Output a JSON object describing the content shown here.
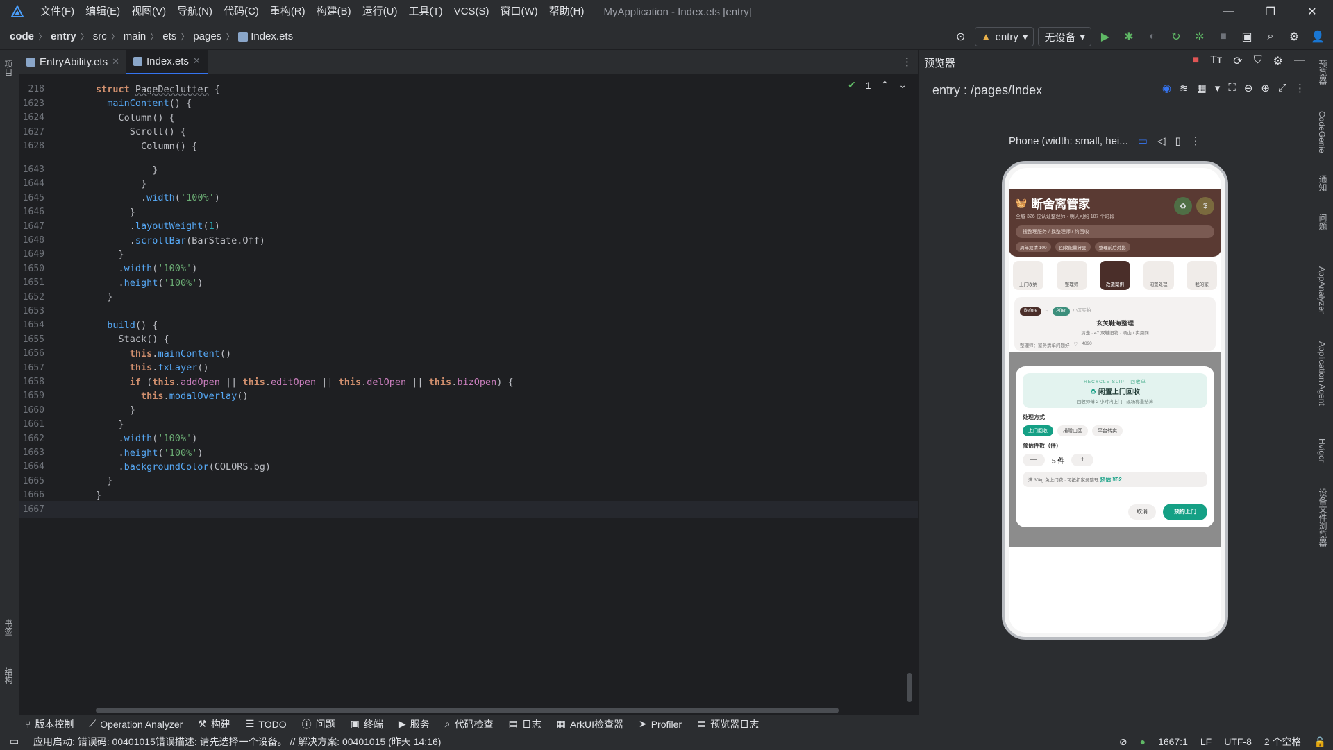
{
  "menubar": {
    "items": [
      "文件(F)",
      "编辑(E)",
      "视图(V)",
      "导航(N)",
      "代码(C)",
      "重构(R)",
      "构建(B)",
      "运行(U)",
      "工具(T)",
      "VCS(S)",
      "窗口(W)",
      "帮助(H)"
    ],
    "window_title": "MyApplication - Index.ets [entry]"
  },
  "breadcrumb": [
    "code",
    "entry",
    "src",
    "main",
    "ets",
    "pages",
    "Index.ets"
  ],
  "toolbar": {
    "module": "entry",
    "device": "无设备"
  },
  "left_strip": {
    "project": "项目",
    "bookmarks": "书签",
    "structure": "结构"
  },
  "tabs": [
    {
      "label": "EntryAbility.ets"
    },
    {
      "label": "Index.ets"
    }
  ],
  "editor": {
    "inspection_count": "1",
    "sticky": [
      {
        "ln": "218",
        "text": "struct PageDeclutter {"
      },
      {
        "ln": "1623",
        "text": "  mainContent() {"
      },
      {
        "ln": "1624",
        "text": "    Column() {"
      },
      {
        "ln": "1627",
        "text": "      Scroll() {"
      },
      {
        "ln": "1628",
        "text": "        Column() {"
      }
    ],
    "lines": [
      {
        "ln": "1643",
        "text": "          }"
      },
      {
        "ln": "1644",
        "text": "        }"
      },
      {
        "ln": "1645",
        "text": "        .width('100%')"
      },
      {
        "ln": "1646",
        "text": "      }"
      },
      {
        "ln": "1647",
        "text": "      .layoutWeight(1)"
      },
      {
        "ln": "1648",
        "text": "      .scrollBar(BarState.Off)"
      },
      {
        "ln": "1649",
        "text": "    }"
      },
      {
        "ln": "1650",
        "text": "    .width('100%')"
      },
      {
        "ln": "1651",
        "text": "    .height('100%')"
      },
      {
        "ln": "1652",
        "text": "  }"
      },
      {
        "ln": "1653",
        "text": ""
      },
      {
        "ln": "1654",
        "text": "  build() {"
      },
      {
        "ln": "1655",
        "text": "    Stack() {"
      },
      {
        "ln": "1656",
        "text": "      this.mainContent()"
      },
      {
        "ln": "1657",
        "text": "      this.fxLayer()"
      },
      {
        "ln": "1658",
        "text": "      if (this.addOpen || this.editOpen || this.delOpen || this.bizOpen) {"
      },
      {
        "ln": "1659",
        "text": "        this.modalOverlay()"
      },
      {
        "ln": "1660",
        "text": "      }"
      },
      {
        "ln": "1661",
        "text": "    }"
      },
      {
        "ln": "1662",
        "text": "    .width('100%')"
      },
      {
        "ln": "1663",
        "text": "    .height('100%')"
      },
      {
        "ln": "1664",
        "text": "    .backgroundColor(COLORS.bg)"
      },
      {
        "ln": "1665",
        "text": "  }"
      },
      {
        "ln": "1666",
        "text": "}"
      },
      {
        "ln": "1667",
        "text": ""
      }
    ]
  },
  "preview": {
    "title": "预览器",
    "path": "entry : /pages/Index",
    "device_label": "Phone (width: small, hei...",
    "app": {
      "title": "断舍离管家",
      "subtitle": "全城 326 位认证整理师 · 明天可约 187 个时段",
      "search_placeholder": "搜整理服务 / 找整理师 / 约回收",
      "chips": [
        "周年双清 100",
        "回收能量分县",
        "整理前后对比"
      ],
      "categories": [
        "上门收纳",
        "整理师",
        "改造案例",
        "闲置处理",
        "我的家"
      ],
      "card": {
        "before": "Before",
        "after": "After",
        "after_note": "小区实拍",
        "title": "玄关鞋海整理",
        "sub": "清走 · 47 双鞋旧物 · 顺山 / 实用网",
        "meta": "整理师：家务清单问题好",
        "likes": "4890"
      },
      "modal": {
        "slip_kicker": "RECYCLE SLIP · 回收单",
        "slip_title": "闲置上门回收",
        "slip_sub": "回收师傅 2 小时内上门 · 现场称重结算",
        "method_label": "处理方式",
        "methods": [
          "上门回收",
          "捐赠山区",
          "平台转卖"
        ],
        "count_label": "预估件数（件）",
        "count_value": "5 件",
        "minus": "—",
        "plus": "+",
        "estimate_text": "满 30kg 免上门费 · 可抵扣家务整理",
        "estimate_value": "预估 ¥52",
        "cancel": "取消",
        "confirm": "预约上门"
      }
    }
  },
  "right_strip": [
    "预览器",
    "CodeGenie",
    "通知",
    "问题",
    "AppAnalyzer",
    "Application Agent",
    "Hvigor",
    "设备文件浏览器"
  ],
  "bottom_tools": [
    "版本控制",
    "Operation Analyzer",
    "构建",
    "TODO",
    "问题",
    "终端",
    "服务",
    "代码检查",
    "日志",
    "ArkUI检查器",
    "Profiler",
    "预览器日志"
  ],
  "status": {
    "message": "应用启动: 错误码: 00401015错误描述: 请先选择一个设备。 // 解决方案: 00401015 (昨天 14:16)",
    "position": "1667:1",
    "line_ending": "LF",
    "encoding": "UTF-8",
    "indent": "2 个空格"
  },
  "colors": {
    "accent": "#3574f0",
    "run": "#5fb865",
    "brand_teal": "#15a085",
    "brand_brown": "#5a3a33"
  }
}
